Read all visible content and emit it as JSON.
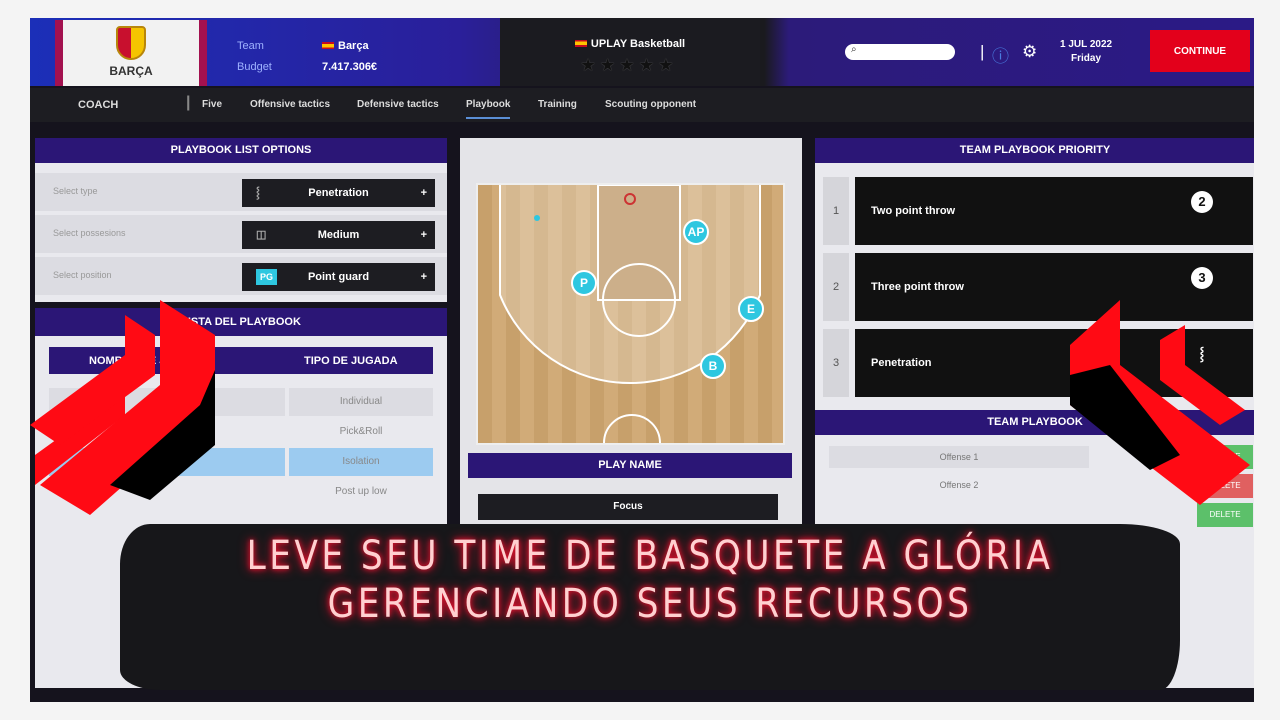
{
  "header": {
    "club_name": "BARÇA",
    "team_label": "Team",
    "team_value": "Barça",
    "budget_label": "Budget",
    "budget_value": "7.417.306€",
    "league": "UPLAY Basketball",
    "stars": "★★★★★",
    "search_placeholder": "",
    "date": "1 JUL 2022",
    "weekday": "Friday",
    "continue_label": "CONTINUE"
  },
  "nav": {
    "section": "COACH",
    "tabs": [
      {
        "label": "Five"
      },
      {
        "label": "Offensive tactics"
      },
      {
        "label": "Defensive tactics"
      },
      {
        "label": "Playbook",
        "active": true
      },
      {
        "label": "Training"
      },
      {
        "label": "Scouting opponent"
      }
    ]
  },
  "options": {
    "title": "PLAYBOOK LIST OPTIONS",
    "rows": [
      {
        "label": "Select type",
        "value": "Penetration",
        "icon": "penetration-icon"
      },
      {
        "label": "Select possesions",
        "value": "Medium",
        "icon": "clock-icon"
      },
      {
        "label": "Select position",
        "value": "Point guard",
        "badge": "PG"
      }
    ]
  },
  "list": {
    "title": "LISTA DEL PLAYBOOK",
    "col1": "NOMBRE DE JUGADA",
    "col2": "TIPO DE JUGADA",
    "rows": [
      {
        "type": "Individual"
      },
      {
        "type": "Pick&Roll"
      },
      {
        "type": "Isolation",
        "selected": true
      },
      {
        "type": "Post up low"
      }
    ]
  },
  "court": {
    "players": [
      "AP",
      "P",
      "E",
      "B"
    ]
  },
  "play": {
    "title": "PLAY NAME",
    "focus_label": "Focus"
  },
  "priority": {
    "title": "TEAM PLAYBOOK PRIORITY",
    "items": [
      {
        "rank": "1",
        "label": "Two point throw",
        "badge": "2"
      },
      {
        "rank": "2",
        "label": "Three point throw",
        "badge": "3"
      },
      {
        "rank": "3",
        "label": "Penetration",
        "badge": ""
      }
    ]
  },
  "team_playbook": {
    "title": "TEAM PLAYBOOK",
    "rows": [
      {
        "name": "Offense 1"
      },
      {
        "name": "Offense 2"
      }
    ],
    "delete_label": "DELETE"
  },
  "overlay": {
    "line1": "LEVE SEU TIME DE BASQUETE A GLÓRIA",
    "line2": "GERENCIANDO SEUS RECURSOS"
  },
  "colors": {
    "accent": "#2b1676",
    "continue": "#e3001b",
    "player": "#2ec7e0",
    "overlay_text": "#ff1030"
  }
}
